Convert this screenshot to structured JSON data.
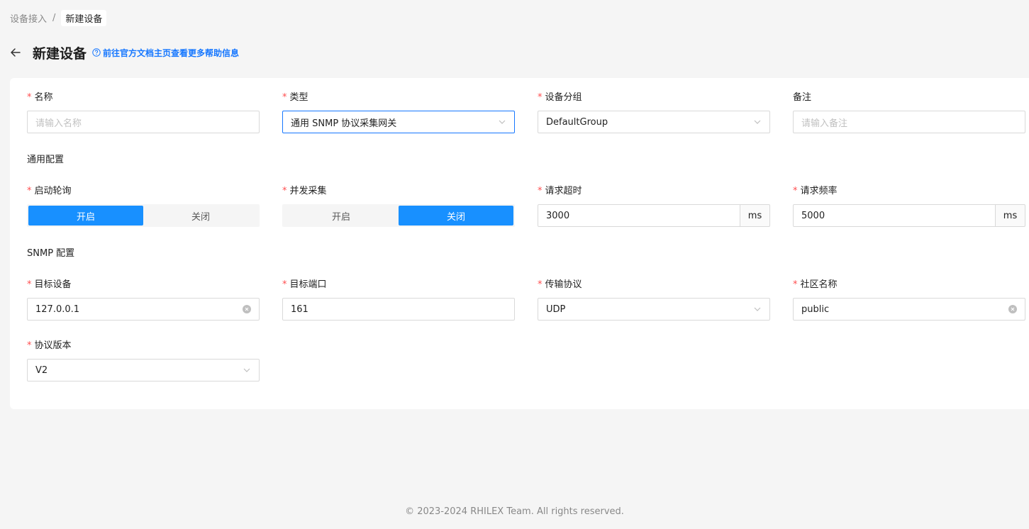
{
  "breadcrumb": {
    "parent": "设备接入",
    "separator": "/",
    "current": "新建设备"
  },
  "header": {
    "title": "新建设备",
    "help_link": "前往官方文档主页查看更多帮助信息"
  },
  "basic": {
    "name": {
      "label": "名称",
      "placeholder": "请输入名称"
    },
    "type": {
      "label": "类型",
      "value": "通用 SNMP 协议采集网关"
    },
    "group": {
      "label": "设备分组",
      "value": "DefaultGroup"
    },
    "remark": {
      "label": "备注",
      "placeholder": "请输入备注"
    }
  },
  "common_config": {
    "title": "通用配置",
    "auto_poll": {
      "label": "启动轮询",
      "on": "开启",
      "off": "关闭",
      "selected": "开启"
    },
    "parallel": {
      "label": "并发采集",
      "on": "开启",
      "off": "关闭",
      "selected": "关闭"
    },
    "timeout": {
      "label": "请求超时",
      "value": "3000",
      "unit": "ms"
    },
    "frequency": {
      "label": "请求频率",
      "value": "5000",
      "unit": "ms"
    }
  },
  "snmp_config": {
    "title": "SNMP 配置",
    "target": {
      "label": "目标设备",
      "value": "127.0.0.1"
    },
    "port": {
      "label": "目标端口",
      "value": "161"
    },
    "transport": {
      "label": "传输协议",
      "value": "UDP"
    },
    "community": {
      "label": "社区名称",
      "value": "public"
    },
    "version": {
      "label": "协议版本",
      "value": "V2"
    }
  },
  "footer": {
    "copyright": "2023-2024 RHILEX Team. All rights reserved."
  },
  "colors": {
    "primary": "#1677ff",
    "required": "#ff4d4f",
    "background": "#f5f5f5"
  }
}
